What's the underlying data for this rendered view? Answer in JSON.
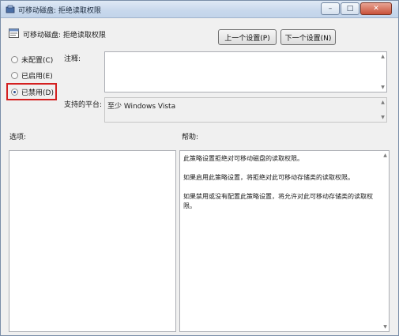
{
  "window": {
    "title": "可移动磁盘: 拒绝读取权限"
  },
  "heading": {
    "title": "可移动磁盘: 拒绝读取权限"
  },
  "buttons": {
    "prev": "上一个设置(P)",
    "next": "下一个设置(N)"
  },
  "radio": {
    "not_configured": "未配置(C)",
    "enabled": "已启用(E)",
    "disabled": "已禁用(D)",
    "selected": "disabled"
  },
  "labels": {
    "comment": "注释:",
    "platform": "支持的平台:",
    "options": "选项:",
    "help": "帮助:"
  },
  "platform_value": "至少 Windows Vista",
  "help": {
    "p1": "此策略设置拒绝对可移动磁盘的读取权限。",
    "p2": "如果启用此策略设置，将拒绝对此可移动存储类的读取权限。",
    "p3": "如果禁用或没有配置此策略设置，将允许对此可移动存储类的读取权限。"
  },
  "icons": {
    "title": "policy-settings-icon",
    "heading": "policy-document-icon",
    "minimize": "minimize-icon",
    "maximize": "maximize-icon",
    "close": "close-icon"
  }
}
